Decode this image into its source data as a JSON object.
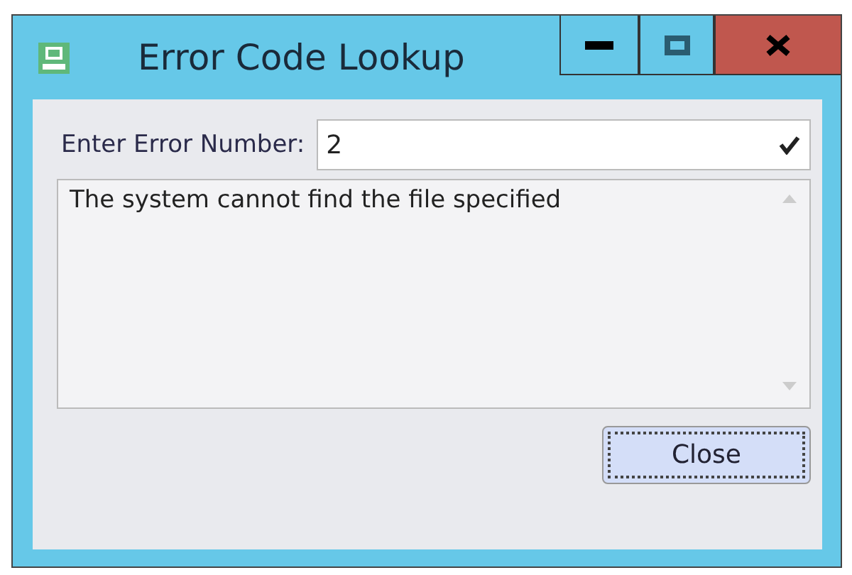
{
  "window": {
    "title": "Error Code Lookup"
  },
  "field": {
    "label": "Enter Error Number:",
    "value": "2"
  },
  "message": {
    "text": "The system cannot find the file specified"
  },
  "buttons": [
    {
      "label": "Close",
      "focused": true
    }
  ]
}
